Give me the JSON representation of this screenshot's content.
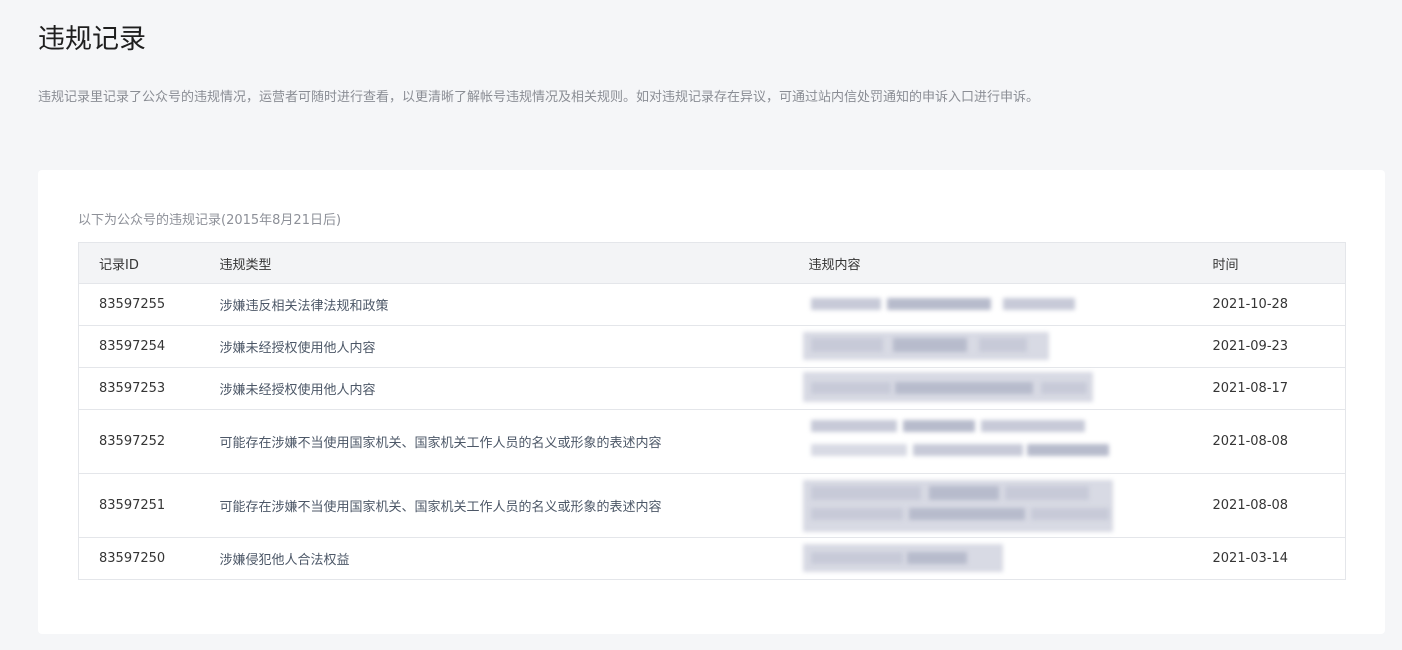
{
  "page": {
    "title": "违规记录",
    "description": "违规记录里记录了公众号的违规情况，运营者可随时进行查看，以更清晰了解帐号违规情况及相关规则。如对违规记录存在异议，可通过站内信处罚通知的申诉入口进行申诉。"
  },
  "card": {
    "caption": "以下为公众号的违规记录(2015年8月21日后)"
  },
  "table": {
    "headers": {
      "id": "记录ID",
      "type": "违规类型",
      "content": "违规内容",
      "time": "时间"
    },
    "rows": [
      {
        "id": "83597255",
        "type": "涉嫌违反相关法律法规和政策",
        "content": "",
        "time": "2021-10-28"
      },
      {
        "id": "83597254",
        "type": "涉嫌未经授权使用他人内容",
        "content": "",
        "time": "2021-09-23"
      },
      {
        "id": "83597253",
        "type": "涉嫌未经授权使用他人内容",
        "content": "",
        "time": "2021-08-17"
      },
      {
        "id": "83597252",
        "type": "可能存在涉嫌不当使用国家机关、国家机关工作人员的名义或形象的表述内容",
        "content": "",
        "time": "2021-08-08"
      },
      {
        "id": "83597251",
        "type": "可能存在涉嫌不当使用国家机关、国家机关工作人员的名义或形象的表述内容",
        "content": "",
        "time": "2021-08-08"
      },
      {
        "id": "83597250",
        "type": "涉嫌侵犯他人合法权益",
        "content": "",
        "time": "2021-03-14"
      }
    ]
  },
  "colors": {
    "background": "#f5f6f8",
    "card": "#ffffff",
    "header_row": "#f3f4f6",
    "border": "#e4e6ea",
    "redaction": "#c7cad8"
  }
}
